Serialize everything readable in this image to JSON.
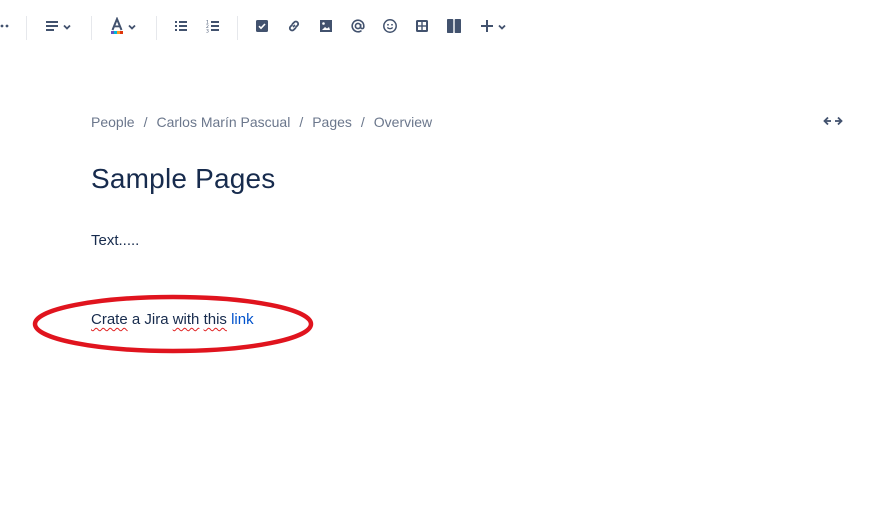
{
  "toolbar": {
    "items": [
      {
        "name": "more-formatting",
        "icon": "more-icon"
      },
      {
        "name": "text-alignment",
        "icon": "align-left-icon",
        "has_dropdown": true
      },
      {
        "name": "text-color",
        "icon": "text-color-icon",
        "has_dropdown": true
      },
      {
        "name": "bullet-list",
        "icon": "bullet-list-icon"
      },
      {
        "name": "numbered-list",
        "icon": "numbered-list-icon"
      },
      {
        "name": "action-item",
        "icon": "checkbox-icon"
      },
      {
        "name": "link",
        "icon": "link-icon"
      },
      {
        "name": "image",
        "icon": "image-icon"
      },
      {
        "name": "mention",
        "icon": "at-icon"
      },
      {
        "name": "emoji",
        "icon": "emoji-icon"
      },
      {
        "name": "table",
        "icon": "table-icon"
      },
      {
        "name": "layouts",
        "icon": "layout-columns-icon"
      },
      {
        "name": "insert",
        "icon": "plus-icon",
        "has_dropdown": true
      }
    ],
    "text_color_swatches": [
      "#6554c0",
      "#00b8d9",
      "#ff991f",
      "#de350b"
    ]
  },
  "breadcrumb": {
    "items": [
      "People",
      "Carlos Marín Pascual",
      "Pages",
      "Overview"
    ],
    "separator": "/"
  },
  "page": {
    "title": "Sample Pages",
    "paragraph1": "Text.....",
    "paragraph2": {
      "word1": "Crate",
      "text1": " a Jira ",
      "word2": "with",
      "text2": " ",
      "word3": "this",
      "text3": " ",
      "link_text": "link"
    }
  },
  "expand_width_icon": "expand-width-icon",
  "colors": {
    "icon": "#42526e",
    "text": "#172b4d",
    "breadcrumb": "#6b778c",
    "link": "#0052cc",
    "annotation": "#e0141e",
    "spellcheck": "#e02020"
  }
}
